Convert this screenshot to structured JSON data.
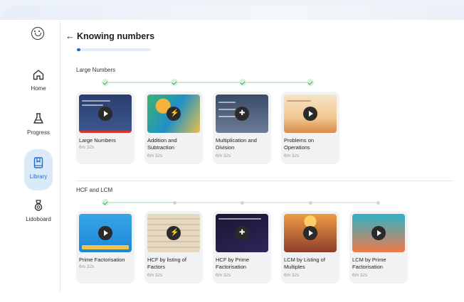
{
  "header": {
    "title": "Knowing numbers",
    "progress": 0.05
  },
  "sidebar": {
    "items": [
      {
        "label": "Home"
      },
      {
        "label": "Progress"
      },
      {
        "label": "Library"
      },
      {
        "label": "Lidoboard"
      }
    ]
  },
  "sections": [
    {
      "title": "Large Numbers",
      "steps": [
        "done",
        "done",
        "done",
        "done"
      ],
      "cards": [
        {
          "title": "Large Numbers",
          "duration": "6m 32s",
          "icon": "play-icon"
        },
        {
          "title": "Addition and Subtraction",
          "duration": "6m 32s",
          "icon": "bolt-icon"
        },
        {
          "title": "Multiplication and Division",
          "duration": "6m 32s",
          "icon": "puzzle-icon"
        },
        {
          "title": "Problems on Operations",
          "duration": "6m 32s",
          "icon": "play-icon"
        }
      ]
    },
    {
      "title": "HCF and LCM",
      "steps": [
        "done",
        "todo",
        "todo",
        "todo",
        "todo"
      ],
      "cards": [
        {
          "title": "Prime Factorisation",
          "duration": "6m 32s",
          "icon": "play-icon"
        },
        {
          "title": "HCF by listing of Factors",
          "duration": "6m 32s",
          "icon": "bolt-icon"
        },
        {
          "title": "HCF by Prime Factorisation",
          "duration": "6m 32s",
          "icon": "puzzle-icon"
        },
        {
          "title": "LCM by Listing of Multiples",
          "duration": "6m 32s",
          "icon": "play-icon"
        },
        {
          "title": "LCM by Prime Factorisation",
          "duration": "6m 32s",
          "icon": "play-icon"
        }
      ]
    }
  ],
  "colors": {
    "accent": "#1c6dd0",
    "done": "#3aa757",
    "library_bg": "#dbeaf9"
  }
}
